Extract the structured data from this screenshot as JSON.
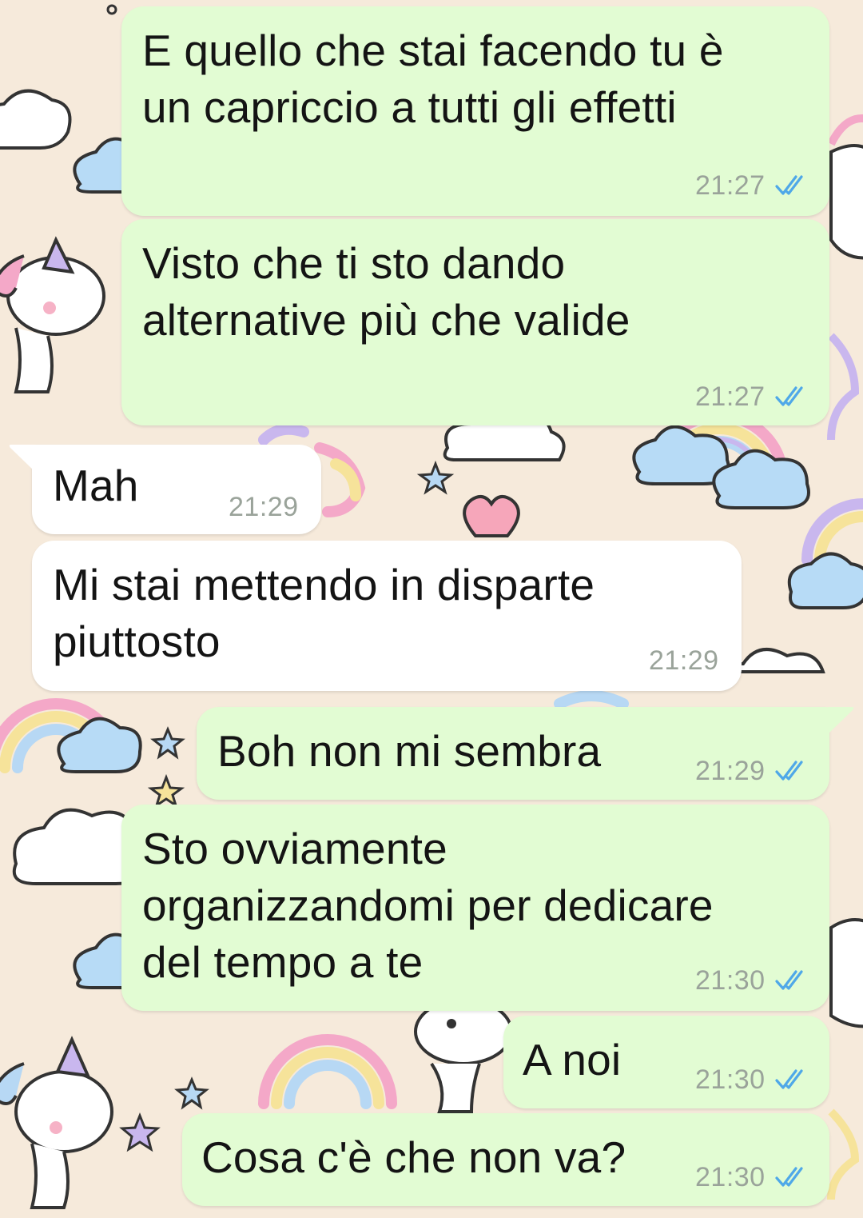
{
  "chat": {
    "messages": [
      {
        "dir": "out",
        "lines": [
          "E quello che stai facendo tu è",
          "un capriccio a tutti gli effetti"
        ],
        "time": "21:27",
        "status": "read-double-check-icon"
      },
      {
        "dir": "out",
        "lines": [
          "Visto che ti sto dando",
          "alternative più che valide"
        ],
        "time": "21:27",
        "status": "read-double-check-icon"
      },
      {
        "dir": "in",
        "lines": [
          "Mah"
        ],
        "time": "21:29"
      },
      {
        "dir": "in",
        "lines": [
          "Mi stai mettendo in disparte",
          "piuttosto"
        ],
        "time": "21:29"
      },
      {
        "dir": "out",
        "lines": [
          "Boh non mi sembra"
        ],
        "time": "21:29",
        "status": "read-double-check-icon"
      },
      {
        "dir": "out",
        "lines": [
          "Sto ovviamente",
          "organizzandomi per dedicare",
          "del tempo a te"
        ],
        "time": "21:30",
        "status": "read-double-check-icon"
      },
      {
        "dir": "out",
        "lines": [
          "A noi"
        ],
        "time": "21:30",
        "status": "read-double-check-icon"
      },
      {
        "dir": "out",
        "lines": [
          "Cosa c'è che non va?"
        ],
        "time": "21:30",
        "status": "read-double-check-icon"
      }
    ]
  },
  "colors": {
    "outgoing_bubble": "#e2fcd3",
    "incoming_bubble": "#ffffff",
    "read_ticks": "#4fa8e8",
    "timestamp": "#9aa39a",
    "wallpaper": "#f6eadb"
  },
  "wallpaper_theme": "unicorns-rainbows-clouds-stars"
}
